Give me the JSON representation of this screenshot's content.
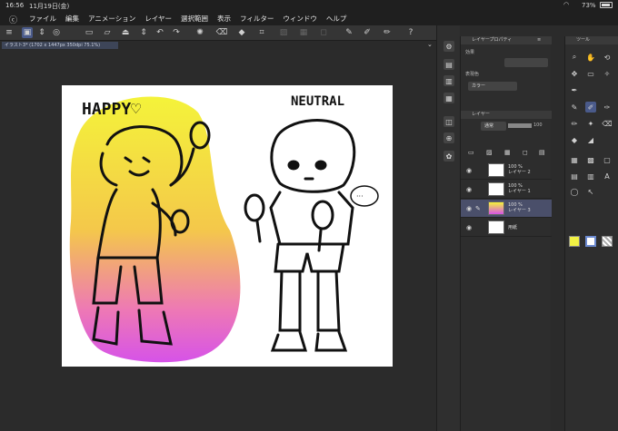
{
  "status": {
    "time": "16:56",
    "date": "11月19日(金)",
    "battery": "73%"
  },
  "menu": [
    "ファイル",
    "編集",
    "アニメーション",
    "レイヤー",
    "選択範囲",
    "表示",
    "フィルター",
    "ウィンドウ",
    "ヘルプ"
  ],
  "tab": {
    "label": "イラスト3* (1702 x 1447px 350dpi 75.1%)"
  },
  "canvas": {
    "text_happy": "HAPPY♡",
    "text_neutral": "NEUTRAL"
  },
  "layer_property": {
    "title": "レイヤープロパティ",
    "effect_label": "効果",
    "color_label": "表現色",
    "color_value": "カラー"
  },
  "layer_panel": {
    "title": "レイヤー",
    "blend_mode": "通常",
    "opacity": "100",
    "layers": [
      {
        "pct": "100 %",
        "mode": "通常",
        "name": "レイヤー 2"
      },
      {
        "pct": "100 %",
        "mode": "通常",
        "name": "レイヤー 1"
      },
      {
        "pct": "100 %",
        "mode": "通常",
        "name": "レイヤー 3"
      },
      {
        "pct": "",
        "mode": "",
        "name": "用紙"
      }
    ]
  },
  "tool_panel": {
    "title": "ツール"
  },
  "colors": {
    "background": "#2b2b2b",
    "panel": "#2d2d2d",
    "selection": "#4a4f6a",
    "fg_color": "#f2f244",
    "sub_color": "#ffffff"
  }
}
